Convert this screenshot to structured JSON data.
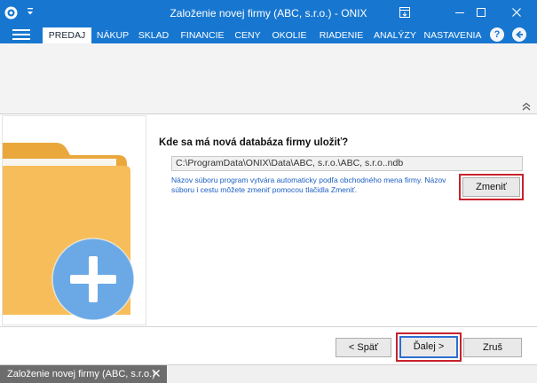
{
  "window": {
    "title": "Založenie novej firmy (ABC, s.r.o.) - ONIX",
    "icons": [
      "app-logo-icon",
      "quick-access-arrow-icon",
      "ribbon-display-icon",
      "minimize-icon",
      "maximize-icon",
      "close-icon"
    ]
  },
  "menu": {
    "tabs": [
      "PREDAJ",
      "NÁKUP",
      "SKLAD",
      "FINANCIE",
      "CENY",
      "OKOLIE",
      "RIADENIE",
      "ANALÝZY",
      "NASTAVENIA"
    ],
    "active_tab": "PREDAJ",
    "help_label": "?",
    "accent_color": "#1777d0"
  },
  "wizard": {
    "question": "Kde sa má nová databáza firmy uložiť?",
    "path_value": "C:\\ProgramData\\ONIX\\Data\\ABC, s.r.o.\\ABC, s.r.o..ndb",
    "hint": "Názov súboru program vytvára automaticky podľa obchodného mena firmy. Názov súboru i cestu môžete zmeniť pomocou tlačidla Zmeniť.",
    "change_label": "Zmeniť",
    "back_label": "< Späť",
    "next_label": "Ďalej >",
    "cancel_label": "Zruš",
    "highlight_color": "#c8222b"
  },
  "tabbar": {
    "document_tab_label": "Založenie novej firmy (ABC, s.r.o.)"
  }
}
